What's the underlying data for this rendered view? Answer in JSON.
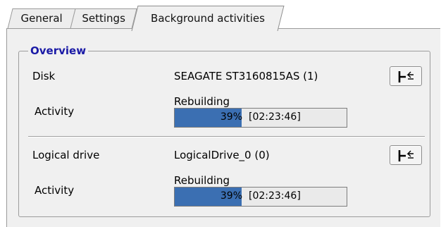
{
  "tabs": [
    {
      "label": "General",
      "active": false
    },
    {
      "label": "Settings",
      "active": false
    },
    {
      "label": "Background activities",
      "active": true
    }
  ],
  "overview": {
    "title": "Overview",
    "rows": [
      {
        "field_label": "Disk",
        "value": "SEAGATE ST3160815AS (1)",
        "activity_label": "Activity",
        "status": "Rebuilding",
        "progress_percent": 39,
        "progress_text": "39%",
        "elapsed": "[02:23:46]",
        "button_icon": "locate-icon"
      },
      {
        "field_label": "Logical drive",
        "value": "LogicalDrive_0 (0)",
        "activity_label": "Activity",
        "status": "Rebuilding",
        "progress_percent": 39,
        "progress_text": "39%",
        "elapsed": "[02:23:46]",
        "button_icon": "locate-icon"
      }
    ]
  },
  "colors": {
    "legend": "#1a1aa6",
    "progress_fill": "#3b6fb2"
  }
}
